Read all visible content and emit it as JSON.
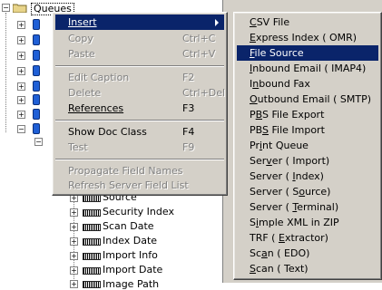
{
  "tree": {
    "root_label": "Queues",
    "fields": [
      "Source",
      "Security Index",
      "Scan Date",
      "Index Date",
      "Import Info",
      "Import Date",
      "Image Path"
    ]
  },
  "context_menu": {
    "insert": "Insert",
    "copy": "Copy",
    "copy_shortcut": "Ctrl+C",
    "paste": "Paste",
    "paste_shortcut": "Ctrl+V",
    "edit_caption": "Edit Caption",
    "edit_caption_shortcut": "F2",
    "delete": "Delete",
    "delete_shortcut": "Ctrl+Del",
    "references": "References",
    "references_shortcut": "F3",
    "show_doc_class": "Show Doc Class",
    "show_doc_class_shortcut": "F4",
    "test": "Test",
    "test_shortcut": "F9",
    "propagate_field_names": "Propagate Field Names",
    "refresh_server_field_list": "Refresh Server Field List"
  },
  "insert_submenu": {
    "items": [
      {
        "label": "CSV File",
        "hotkey": 0
      },
      {
        "label": "Express Index ( OMR)",
        "hotkey": 0
      },
      {
        "label": "File Source",
        "hotkey": 0
      },
      {
        "label": "Inbound Email ( IMAP4)",
        "hotkey": 0
      },
      {
        "label": "Inbound Fax",
        "hotkey": 1
      },
      {
        "label": "Outbound Email ( SMTP)",
        "hotkey": 0
      },
      {
        "label": "PBS File Export",
        "hotkey": 1
      },
      {
        "label": "PBS File Import",
        "hotkey": 2
      },
      {
        "label": "Print Queue",
        "hotkey": 2
      },
      {
        "label": "Server ( Import)",
        "hotkey": 3
      },
      {
        "label": "Server ( Index)",
        "hotkey": 9
      },
      {
        "label": "Server ( Source)",
        "hotkey": 10
      },
      {
        "label": "Server ( Terminal)",
        "hotkey": 9
      },
      {
        "label": "Simple XML in ZIP",
        "hotkey": 1
      },
      {
        "label": "TRF ( Extractor)",
        "hotkey": 6
      },
      {
        "label": "Scan ( EDO)",
        "hotkey": 2
      },
      {
        "label": "Scan ( Text)",
        "hotkey": 0
      }
    ],
    "selected_index": 2,
    "highlight_color": "#0a246a"
  }
}
